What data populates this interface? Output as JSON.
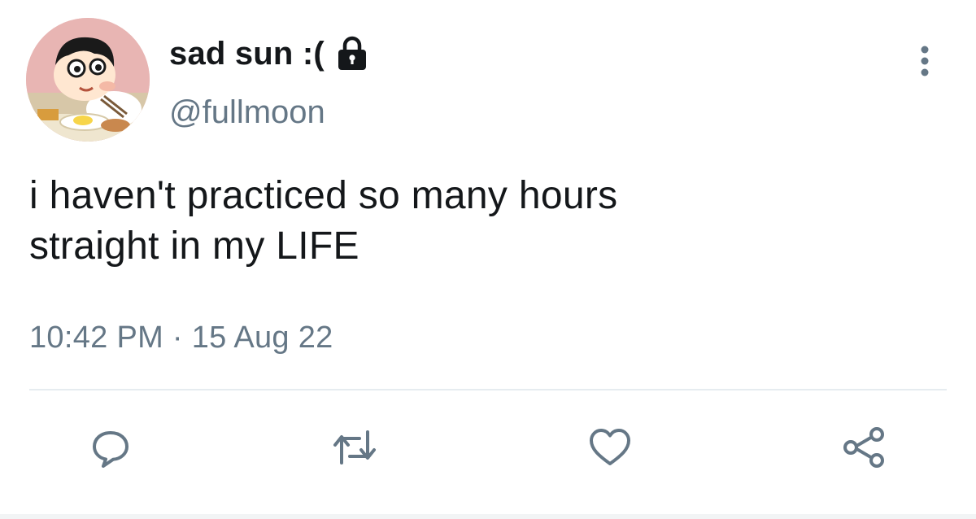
{
  "tweet": {
    "display_name": "sad sun :(",
    "handle": "@fullmoon",
    "text_lines": [
      "i haven't practiced so many hours",
      "straight in my LIFE"
    ],
    "timestamp": "10:42 PM · 15 Aug 22"
  },
  "icons": {
    "avatar": "cartoon-avatar",
    "verified_lock": "lock-icon",
    "more": "more-vertical-icon",
    "reply": "reply-icon",
    "retweet": "retweet-icon",
    "like": "heart-icon",
    "share": "share-icon"
  },
  "colors": {
    "text": "#14171a",
    "secondary": "#657786",
    "action_icon": "#657786",
    "divider": "#e6ecf0"
  }
}
